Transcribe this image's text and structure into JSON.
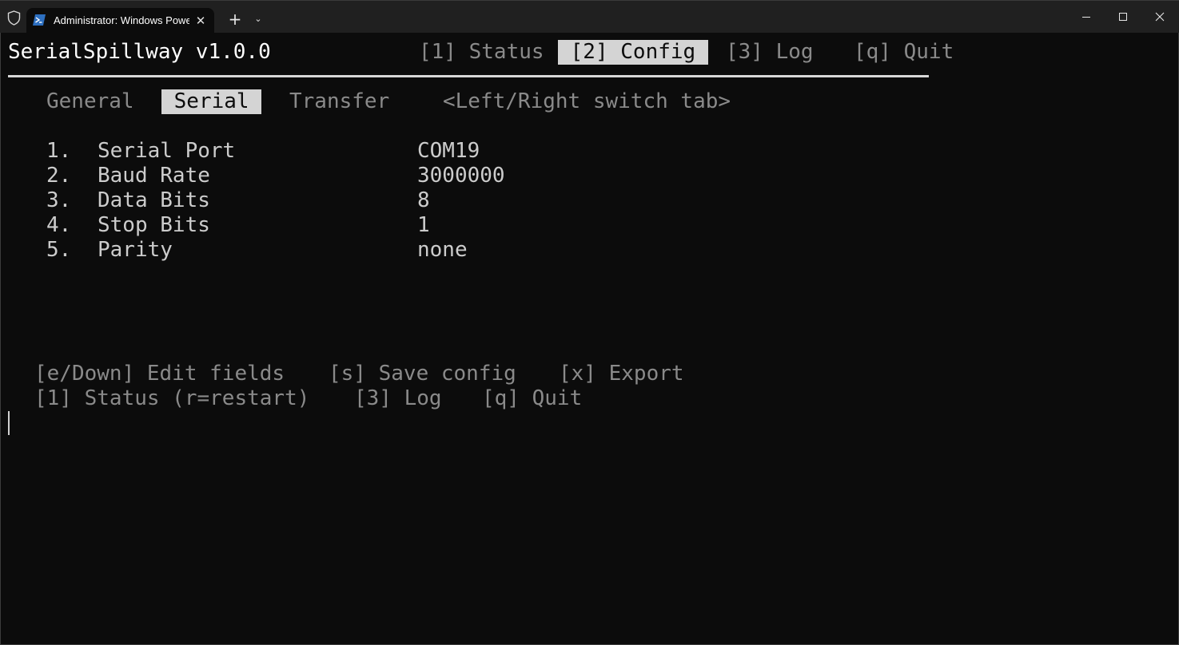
{
  "window": {
    "tab_title": "Administrator: Windows PowerShell",
    "tab_close_glyph": "✕",
    "new_tab_glyph": "+",
    "dropdown_glyph": "⌄"
  },
  "app": {
    "name": "SerialSpillway v1.0.0",
    "nav": [
      {
        "label": "[1] Status",
        "active": false
      },
      {
        "label": " [2] Config ",
        "active": true
      },
      {
        "label": "[3] Log",
        "active": false
      },
      {
        "label": "[q] Quit",
        "active": false
      }
    ],
    "subtabs": [
      {
        "label": "General",
        "active": false
      },
      {
        "label": " Serial ",
        "active": true
      },
      {
        "label": "Transfer",
        "active": false
      }
    ],
    "subtab_hint": "<Left/Right switch tab>"
  },
  "settings": [
    {
      "num": "1.",
      "label": "Serial Port",
      "value": "COM19"
    },
    {
      "num": "2.",
      "label": "Baud Rate",
      "value": "3000000"
    },
    {
      "num": "3.",
      "label": "Data Bits",
      "value": "8"
    },
    {
      "num": "4.",
      "label": "Stop Bits",
      "value": "1"
    },
    {
      "num": "5.",
      "label": "Parity",
      "value": "none"
    }
  ],
  "help": {
    "line1": [
      {
        "label": "[e/Down] Edit fields"
      },
      {
        "label": "[s] Save config"
      },
      {
        "label": "[x] Export"
      }
    ],
    "line2": [
      {
        "label": "[1] Status (r=restart)"
      },
      {
        "label": "[3] Log"
      },
      {
        "label": "[q] Quit"
      }
    ]
  },
  "colors": {
    "background": "#0c0c0c",
    "titlebar": "#202020",
    "foreground": "#cccccc",
    "dim": "#8a8a8a",
    "highlight_bg": "#d4d4d4"
  }
}
